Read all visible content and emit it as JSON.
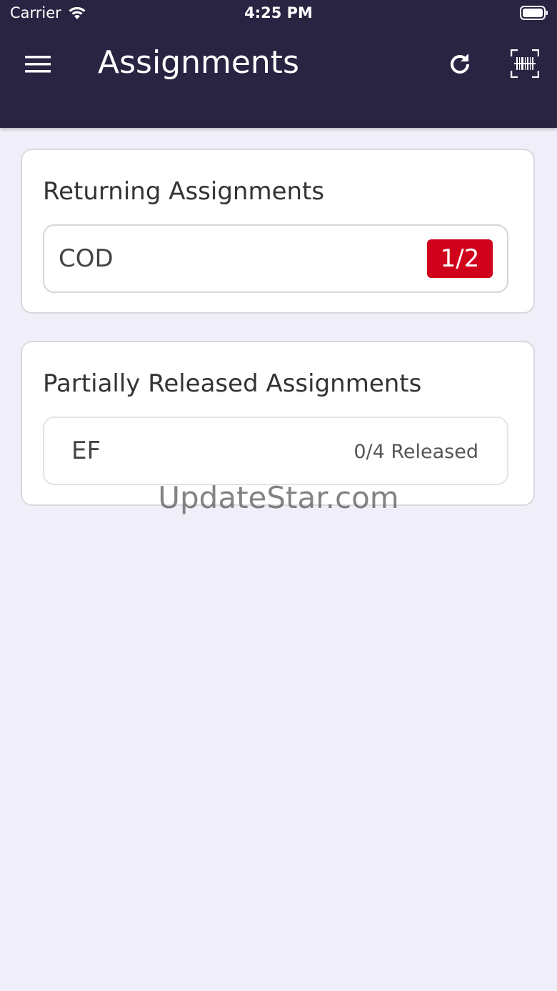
{
  "status_bar": {
    "carrier": "Carrier",
    "time": "4:25 PM"
  },
  "header": {
    "title": "Assignments",
    "menu_icon": "hamburger-menu-icon",
    "refresh_icon": "refresh-icon",
    "scan_icon": "barcode-scan-icon",
    "background_color": "#282442"
  },
  "sections": {
    "returning": {
      "title": "Returning Assignments",
      "items": [
        {
          "label": "COD",
          "badge": "1/2"
        }
      ]
    },
    "partial": {
      "title": "Partially Released Assignments",
      "items": [
        {
          "label": "EF",
          "status": "0/4 Released"
        }
      ]
    }
  },
  "colors": {
    "badge": "#d0021b",
    "page_background": "#f0eff9"
  },
  "watermark": "UpdateStar.com"
}
